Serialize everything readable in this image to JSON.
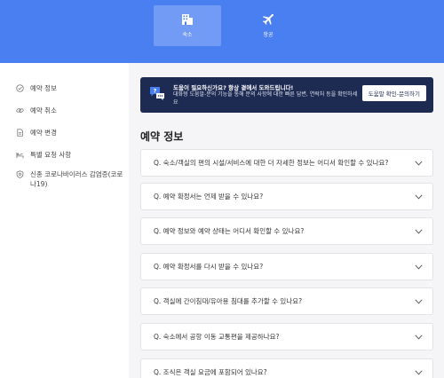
{
  "topnav": {
    "items": [
      {
        "label": "숙소",
        "icon": "hotel-icon",
        "active": true
      },
      {
        "label": "항공",
        "icon": "airplane-icon",
        "active": false
      }
    ]
  },
  "sidebar": {
    "items": [
      {
        "label": "예약 정보",
        "icon": "check-circle-icon"
      },
      {
        "label": "예약 취소",
        "icon": "link-icon"
      },
      {
        "label": "예약 변경",
        "icon": "document-icon"
      },
      {
        "label": "특별 요청 사항",
        "icon": "bed-icon"
      },
      {
        "label": "신종 코로나바이러스 감염증(코로나19)",
        "icon": "shield-icon"
      }
    ]
  },
  "help_banner": {
    "icon": "help-chat-icon",
    "title": "도움이 필요하신가요? 항상 곁에서 도와드립니다!",
    "description": "대화형 도움말-문의 기능을 통해 문의 사항에 대한 빠른 답변, 연락처 등을 확인하세요",
    "button_label": "도움말 확인-문의하기"
  },
  "section": {
    "title": "예약 정보"
  },
  "faqs": [
    {
      "question": "Q. 숙소/객실의 편의 시설/서비스에 대한 더 자세한 정보는 어디서 확인할 수 있나요?"
    },
    {
      "question": "Q. 예약 확정서는 언제 받을 수 있나요?"
    },
    {
      "question": "Q. 예약 정보와 예약 상태는 어디서 확인할 수 있나요?"
    },
    {
      "question": "Q. 예약 확정서를 다시 받을 수 있나요?"
    },
    {
      "question": "Q. 객실에 간이침대/유아용 침대를 추가할 수 있나요?"
    },
    {
      "question": "Q. 숙소에서 공항 이동 교통편을 제공하나요?"
    },
    {
      "question": "Q. 조식은 객실 요금에 포함되어 있나요?"
    }
  ],
  "colors": {
    "header_blue": "#4a7ff2",
    "banner_navy": "#1d2a52",
    "background": "#f5f5f7"
  }
}
